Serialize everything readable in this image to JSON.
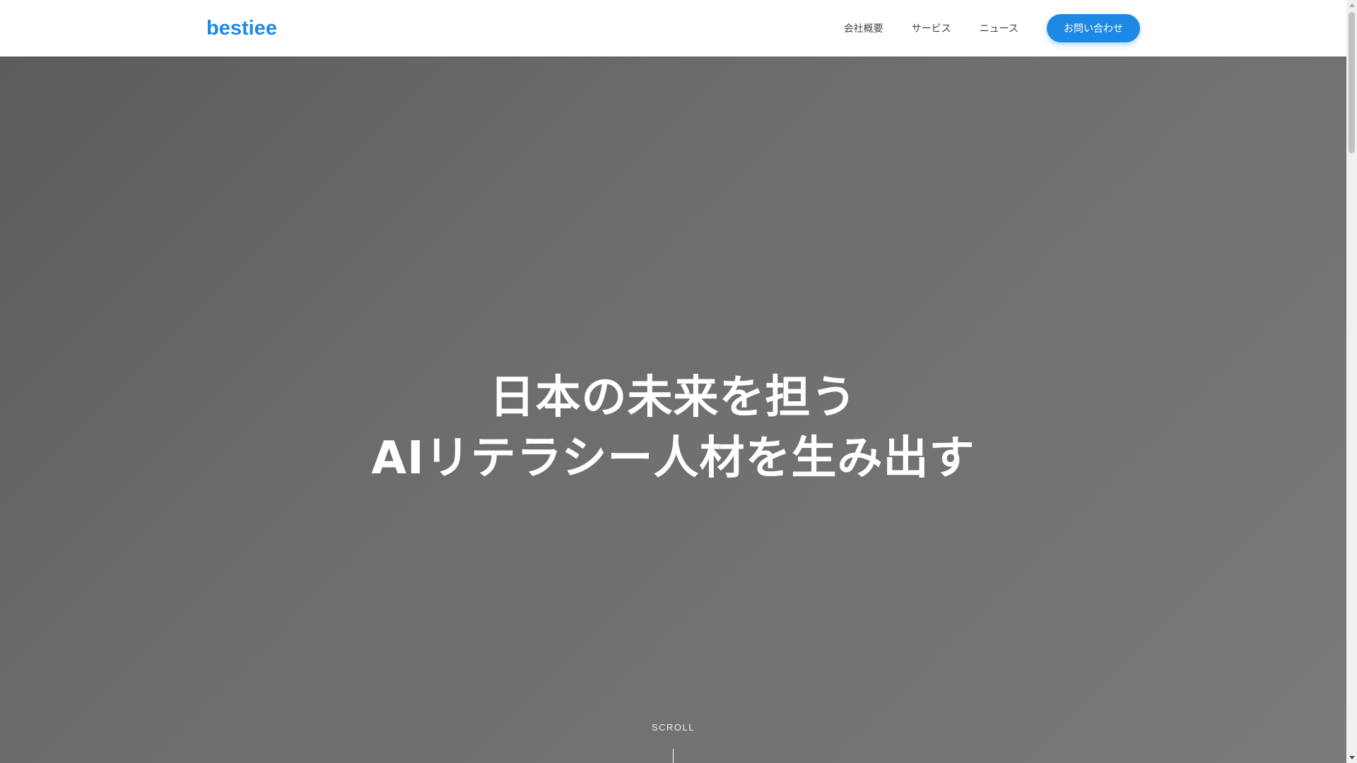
{
  "header": {
    "logo": "bestiee",
    "nav": [
      {
        "label": "会社概要"
      },
      {
        "label": "サービス"
      },
      {
        "label": "ニュース"
      }
    ],
    "contact_label": "お問い合わせ"
  },
  "hero": {
    "title_line1": "日本の未来を担う",
    "title_line2": "AIリテラシー人材を生み出す",
    "scroll_label": "SCROLL"
  },
  "colors": {
    "brand": "#1e88e5",
    "hero_overlay": "#6d6d6d",
    "text_on_hero": "#ffffff"
  },
  "icons": {
    "scroll_up": "triangle-up",
    "scroll_down": "triangle-down"
  }
}
